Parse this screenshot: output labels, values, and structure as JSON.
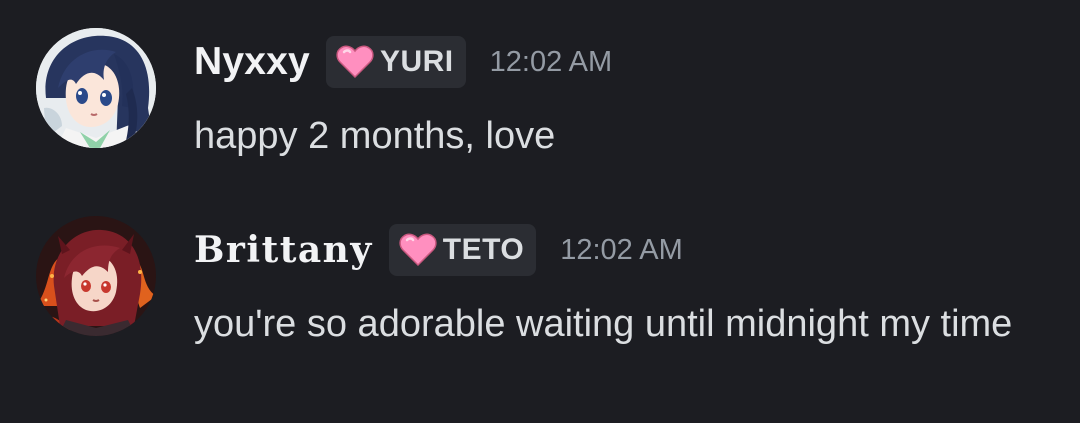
{
  "messages": [
    {
      "username": "Nyxxy",
      "tag": {
        "label": "YURI",
        "icon": "pink-heart-icon",
        "color": "#ff8fbf"
      },
      "timestamp": "12:02 AM",
      "text": "happy 2 months, love"
    },
    {
      "username": "Brittany",
      "tag": {
        "label": "TETO",
        "icon": "pink-heart-icon",
        "color": "#ff8fbf"
      },
      "timestamp": "12:02 AM",
      "text": "you're so adorable waiting until midnight my time"
    }
  ],
  "colors": {
    "background": "#1c1d22",
    "username": "#f2f3f5",
    "message_text": "#dbdee1",
    "timestamp": "#949ba4",
    "tag_background": "#2b2d33"
  }
}
